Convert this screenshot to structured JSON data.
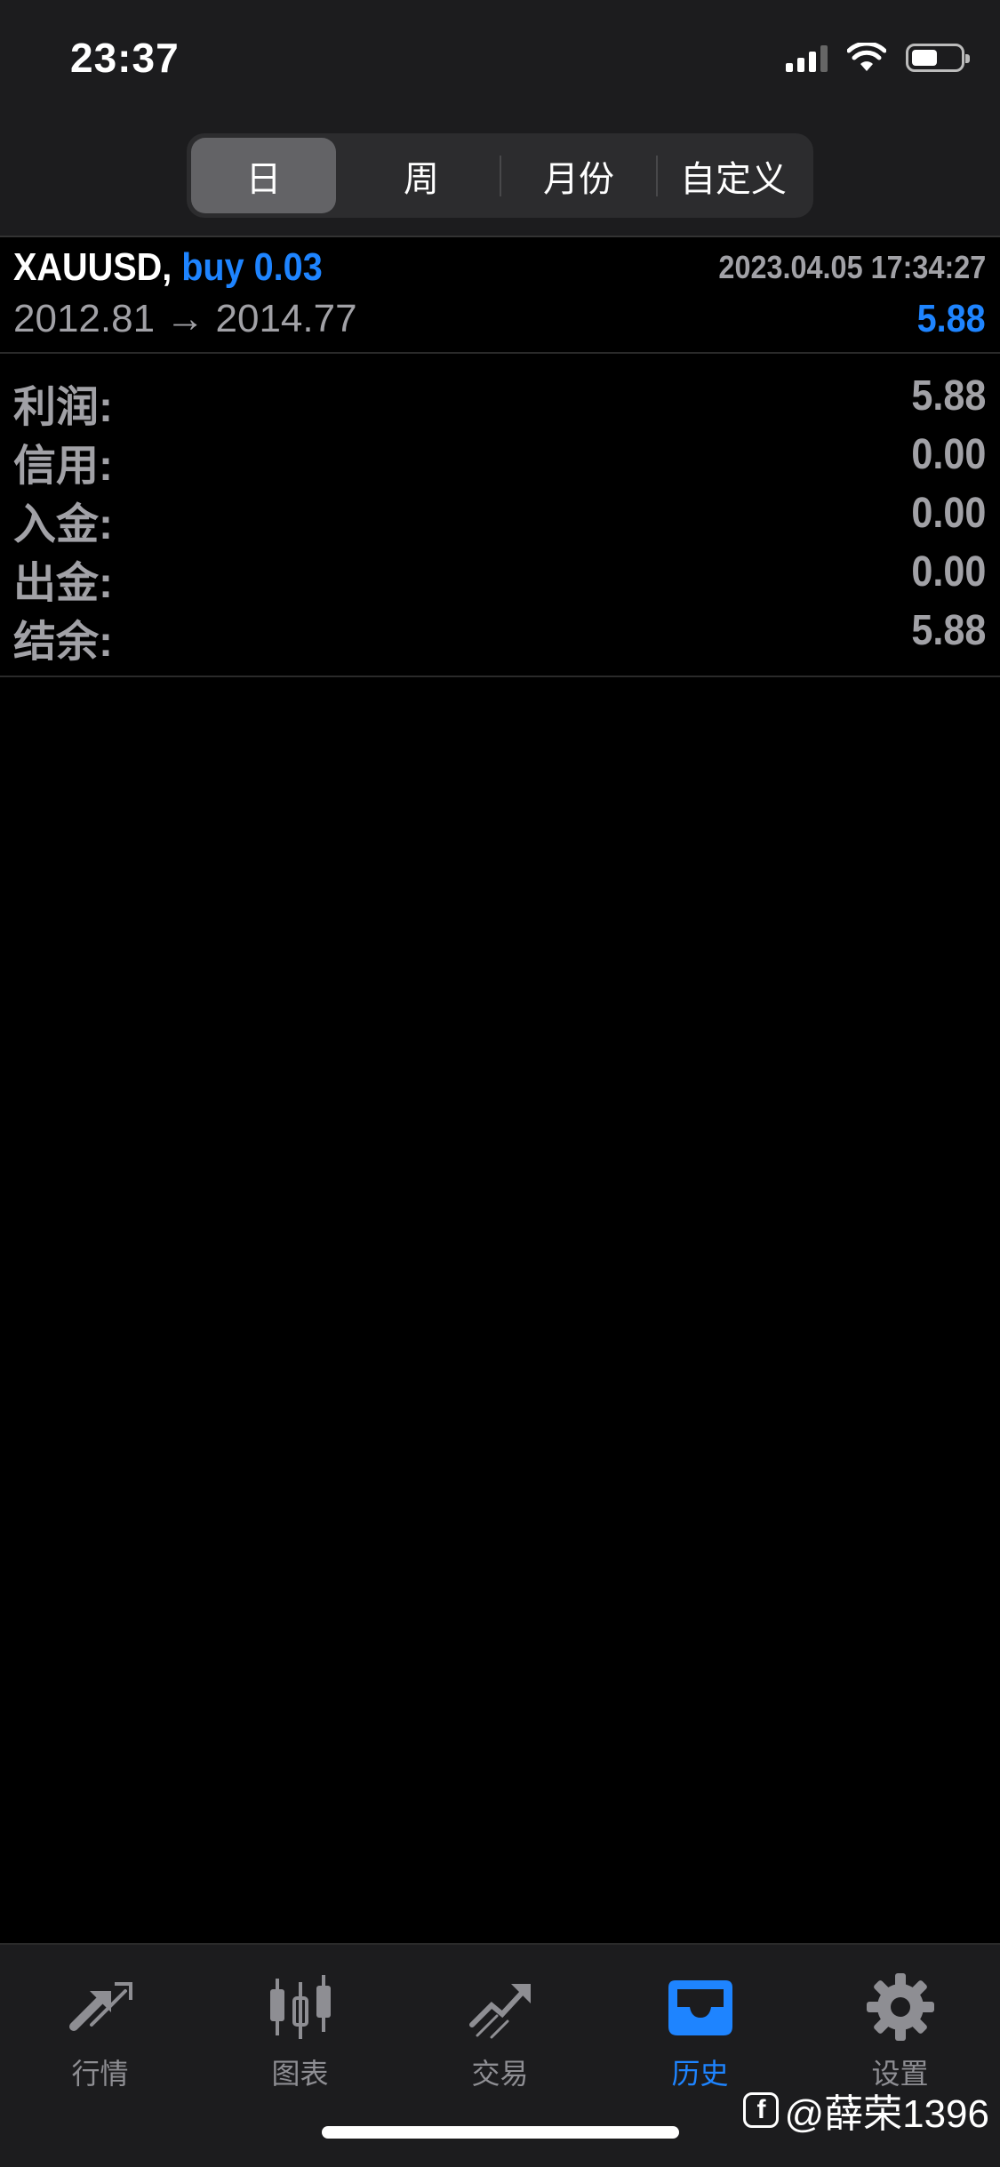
{
  "status": {
    "time": "23:37"
  },
  "period_tabs": [
    {
      "label": "日",
      "active": true
    },
    {
      "label": "周",
      "active": false
    },
    {
      "label": "月份",
      "active": false
    },
    {
      "label": "自定义",
      "active": false
    }
  ],
  "trade": {
    "symbol": "XAUUSD,",
    "side": "buy 0.03",
    "datetime": "2023.04.05 17:34:27",
    "prices": "2012.81 → 2014.77",
    "profit": "5.88"
  },
  "summary": [
    {
      "label": "利润:",
      "value": "5.88"
    },
    {
      "label": "信用:",
      "value": "0.00"
    },
    {
      "label": "入金:",
      "value": "0.00"
    },
    {
      "label": "出金:",
      "value": "0.00"
    },
    {
      "label": "结余:",
      "value": "5.88"
    }
  ],
  "tabbar": [
    {
      "label": "行情",
      "icon": "quotes-arrows-icon",
      "active": false
    },
    {
      "label": "图表",
      "icon": "candlestick-chart-icon",
      "active": false
    },
    {
      "label": "交易",
      "icon": "trade-trend-icon",
      "active": false
    },
    {
      "label": "历史",
      "icon": "history-inbox-icon",
      "active": true
    },
    {
      "label": "设置",
      "icon": "gear-icon",
      "active": false
    }
  ],
  "watermark": {
    "icon": "f",
    "text": "@薛荣1396"
  },
  "colors": {
    "accent": "#1e84ff",
    "muted": "#a1a1a6",
    "background": "#000000",
    "bar": "#1c1c1e"
  }
}
